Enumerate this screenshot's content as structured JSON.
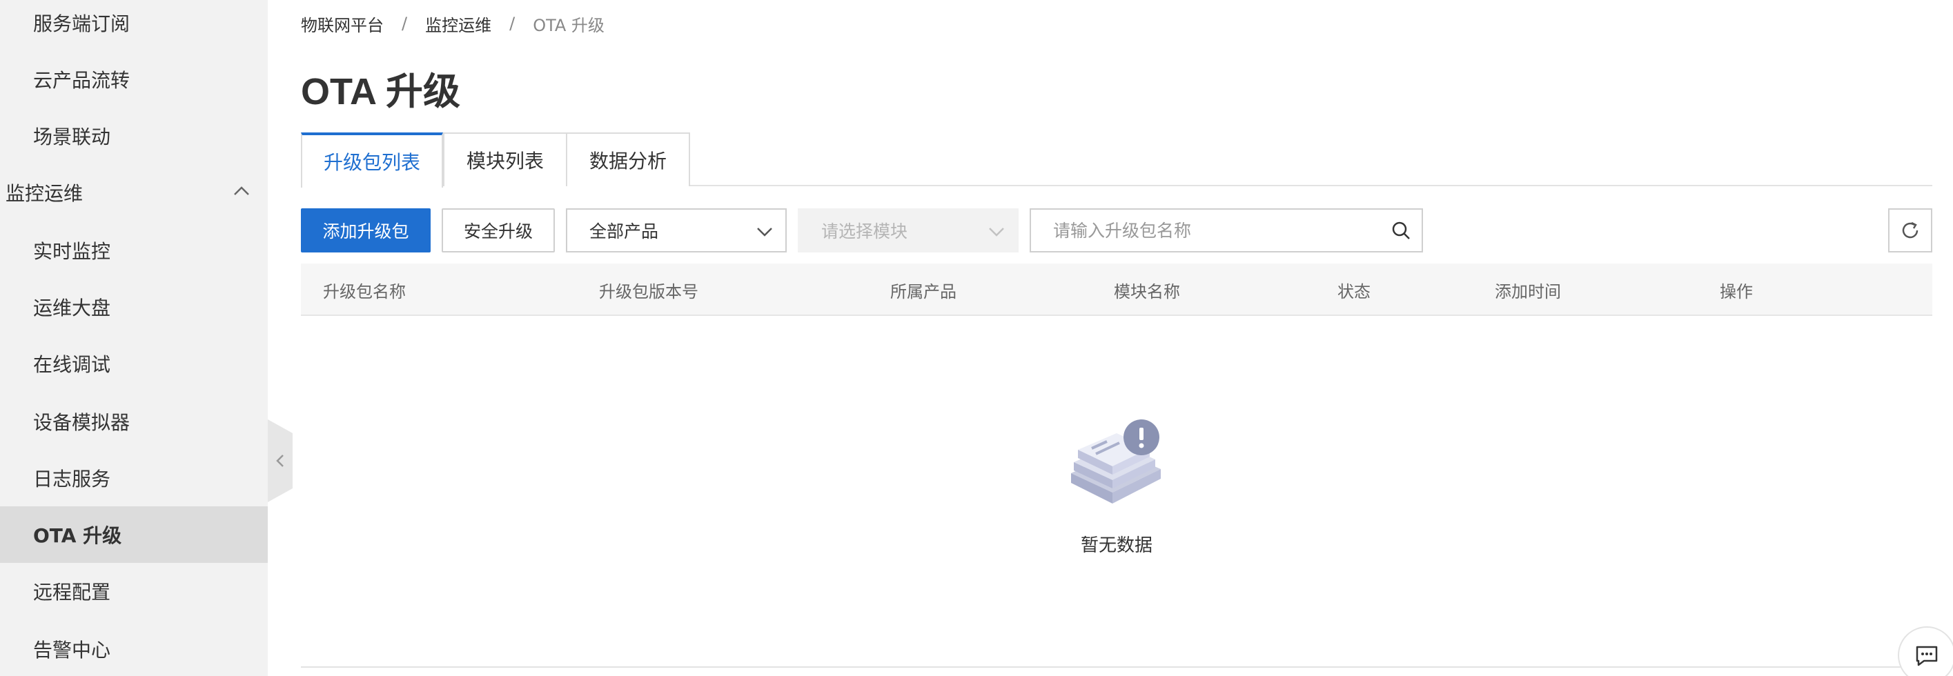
{
  "sidebar": {
    "items": [
      {
        "label": "服务端订阅"
      },
      {
        "label": "云产品流转"
      },
      {
        "label": "场景联动"
      },
      {
        "label": "监控运维"
      },
      {
        "label": "实时监控"
      },
      {
        "label": "运维大盘"
      },
      {
        "label": "在线调试"
      },
      {
        "label": "设备模拟器"
      },
      {
        "label": "日志服务"
      },
      {
        "label": "OTA 升级"
      },
      {
        "label": "远程配置"
      },
      {
        "label": "告警中心"
      }
    ]
  },
  "breadcrumb": {
    "items": [
      "物联网平台",
      "监控运维",
      "OTA 升级"
    ],
    "separator": "/"
  },
  "page": {
    "title": "OTA 升级"
  },
  "tabs": [
    {
      "label": "升级包列表"
    },
    {
      "label": "模块列表"
    },
    {
      "label": "数据分析"
    }
  ],
  "toolbar": {
    "add_label": "添加升级包",
    "secure_label": "安全升级",
    "product_select": "全部产品",
    "module_select_placeholder": "请选择模块",
    "search_placeholder": "请输入升级包名称"
  },
  "table": {
    "columns": [
      "升级包名称",
      "升级包版本号",
      "所属产品",
      "模块名称",
      "状态",
      "添加时间",
      "操作"
    ],
    "rows": []
  },
  "empty": {
    "text": "暂无数据"
  },
  "colors": {
    "accent": "#1f6fd0",
    "sidebar_bg": "#f2f2f2",
    "active_item_bg": "#dcdcdc"
  }
}
